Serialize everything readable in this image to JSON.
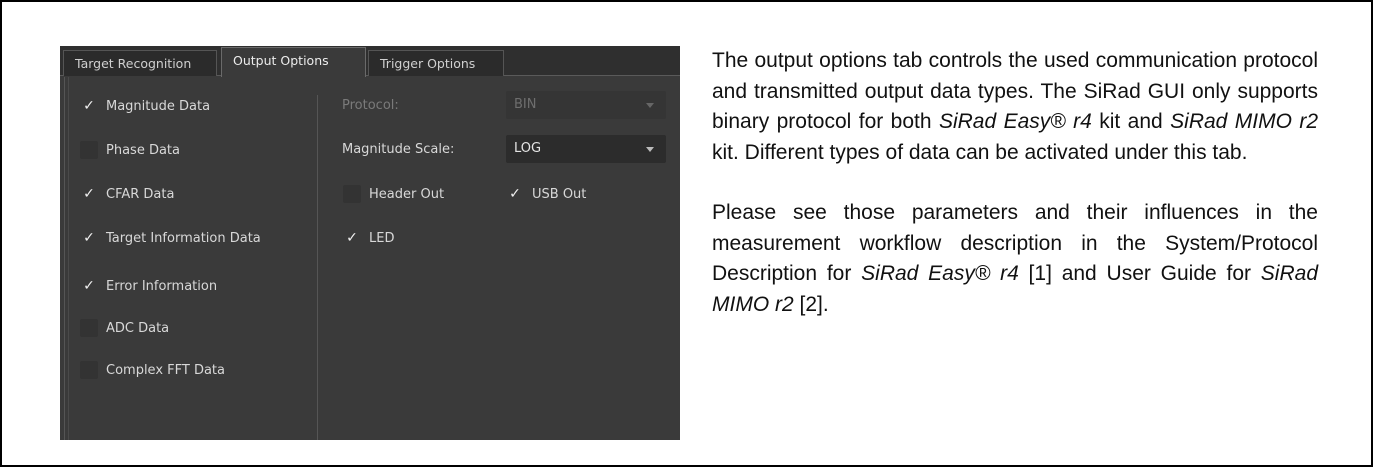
{
  "tabs": [
    {
      "label": "Target Recognition",
      "active": false
    },
    {
      "label": "Output Options",
      "active": true
    },
    {
      "label": "Trigger Options",
      "active": false
    }
  ],
  "checkmark": "✓",
  "data_checkboxes": [
    {
      "label": "Magnitude Data",
      "checked": true
    },
    {
      "label": "Phase Data",
      "checked": false
    },
    {
      "label": "CFAR Data",
      "checked": true
    },
    {
      "label": "Target Information Data",
      "checked": true
    },
    {
      "label": "Error Information",
      "checked": true
    },
    {
      "label": "ADC Data",
      "checked": false
    },
    {
      "label": "Complex FFT Data",
      "checked": false
    }
  ],
  "protocol": {
    "label": "Protocol:",
    "value": "BIN",
    "enabled": false
  },
  "magnitude_scale": {
    "label": "Magnitude Scale:",
    "value": "LOG",
    "enabled": true
  },
  "output_checkboxes": {
    "header_out": {
      "label": "Header Out",
      "checked": false
    },
    "usb_out": {
      "label": "USB Out",
      "checked": true
    },
    "led": {
      "label": "LED",
      "checked": true
    }
  },
  "description": {
    "p1": {
      "t1": "The output options tab controls the used communication protocol and transmitted output data types. The SiRad GUI only supports binary protocol for both ",
      "i1": "SiRad Easy® r4",
      "t2": " kit and ",
      "i2": "SiRad MIMO r2",
      "t3": " kit. Different types of data can be activated under this tab."
    },
    "p2": {
      "t1": "Please see those parameters and their influences in the measurement workflow description in the System/Protocol Description for ",
      "i1": "SiRad Easy® r4",
      "t2": " [1] and User Guide for ",
      "i2": "SiRad MIMO r2",
      "t3": " [2]."
    }
  }
}
